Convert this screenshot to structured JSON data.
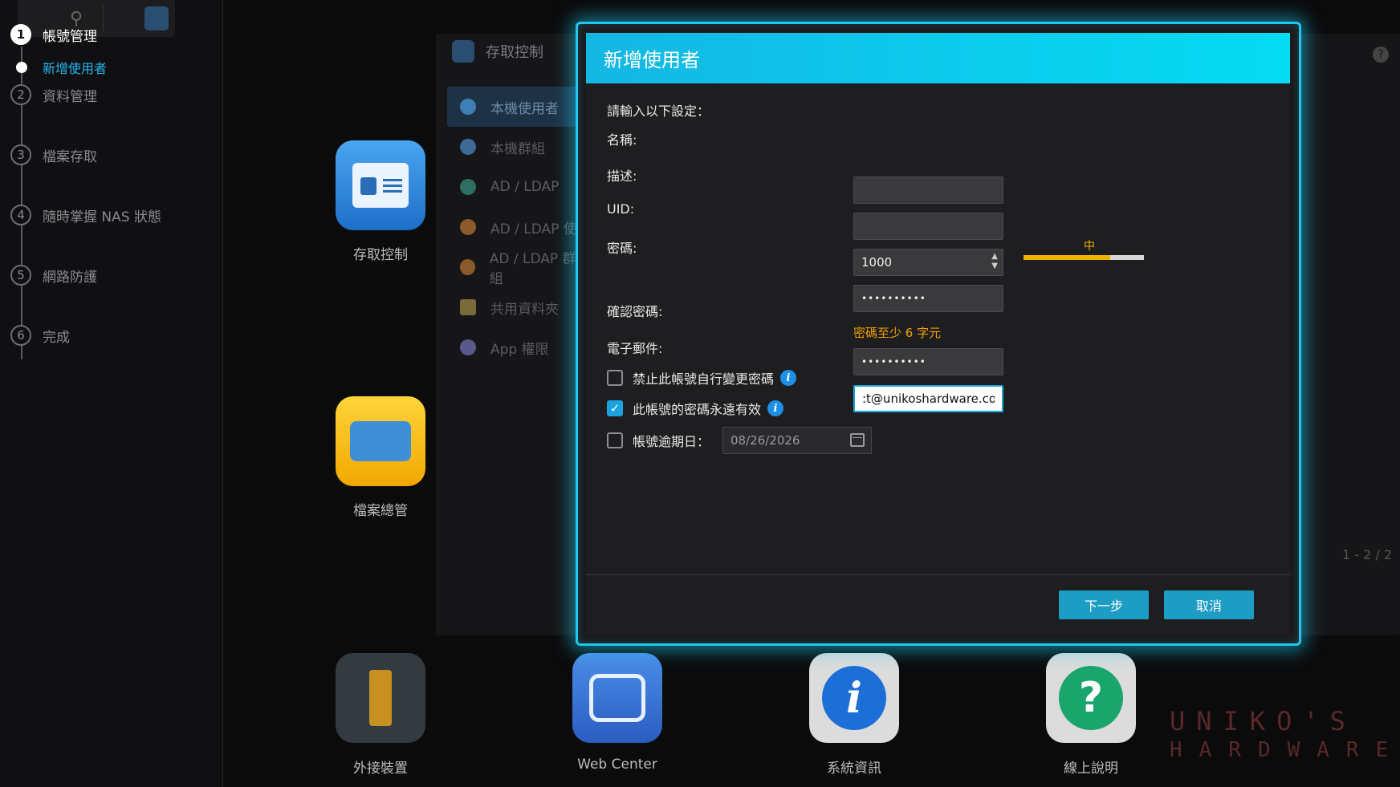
{
  "wizard": {
    "steps": [
      {
        "num": "1",
        "label": "帳號管理"
      },
      {
        "num": "2",
        "label": "資料管理"
      },
      {
        "num": "3",
        "label": "檔案存取"
      },
      {
        "num": "4",
        "label": "隨時掌握 NAS 狀態"
      },
      {
        "num": "5",
        "label": "網路防護"
      },
      {
        "num": "6",
        "label": "完成"
      }
    ],
    "substep": "新增使用者"
  },
  "background": {
    "window_title": "存取控制",
    "menu": [
      "本機使用者",
      "本機群組",
      "AD / LDAP",
      "AD / LDAP 使",
      "AD / LDAP 群組",
      "共用資料夾",
      "App 權限"
    ],
    "pager": "1 - 2 / 2",
    "apps": {
      "access_control": "存取控制",
      "file_manager": "檔案總管",
      "external": "外接裝置",
      "web_center": "Web Center",
      "system_info": "系統資訊",
      "help": "線上說明"
    }
  },
  "dialog": {
    "title": "新增使用者",
    "intro": "請輸入以下設定：",
    "fields": {
      "name_label": "名稱:",
      "name_value": "",
      "desc_label": "描述:",
      "desc_value": "",
      "uid_label": "UID:",
      "uid_value": "1000",
      "password_label": "密碼:",
      "password_value": "••••••••••",
      "confirm_label": "確認密碼:",
      "confirm_value": "••••••••••",
      "email_label": "電子郵件:",
      "email_value": ":t@unikoshardware.com"
    },
    "strength": {
      "label": "中",
      "level": 0.72
    },
    "hint": "密碼至少 6 字元",
    "options": {
      "disallow_change": "禁止此帳號自行變更密碼",
      "never_expire": "此帳號的密碼永遠有效",
      "expire_date_label": "帳號逾期日：",
      "expire_date_value": "08/26/2026"
    },
    "buttons": {
      "next": "下一步",
      "cancel": "取消"
    }
  },
  "watermark": {
    "line1": "UNIKO'S",
    "line2": "HARDWARE"
  },
  "colors": {
    "accent": "#05dcf4",
    "button": "#1e9dc4",
    "warning": "#f0a000",
    "link": "#27b6f2"
  }
}
